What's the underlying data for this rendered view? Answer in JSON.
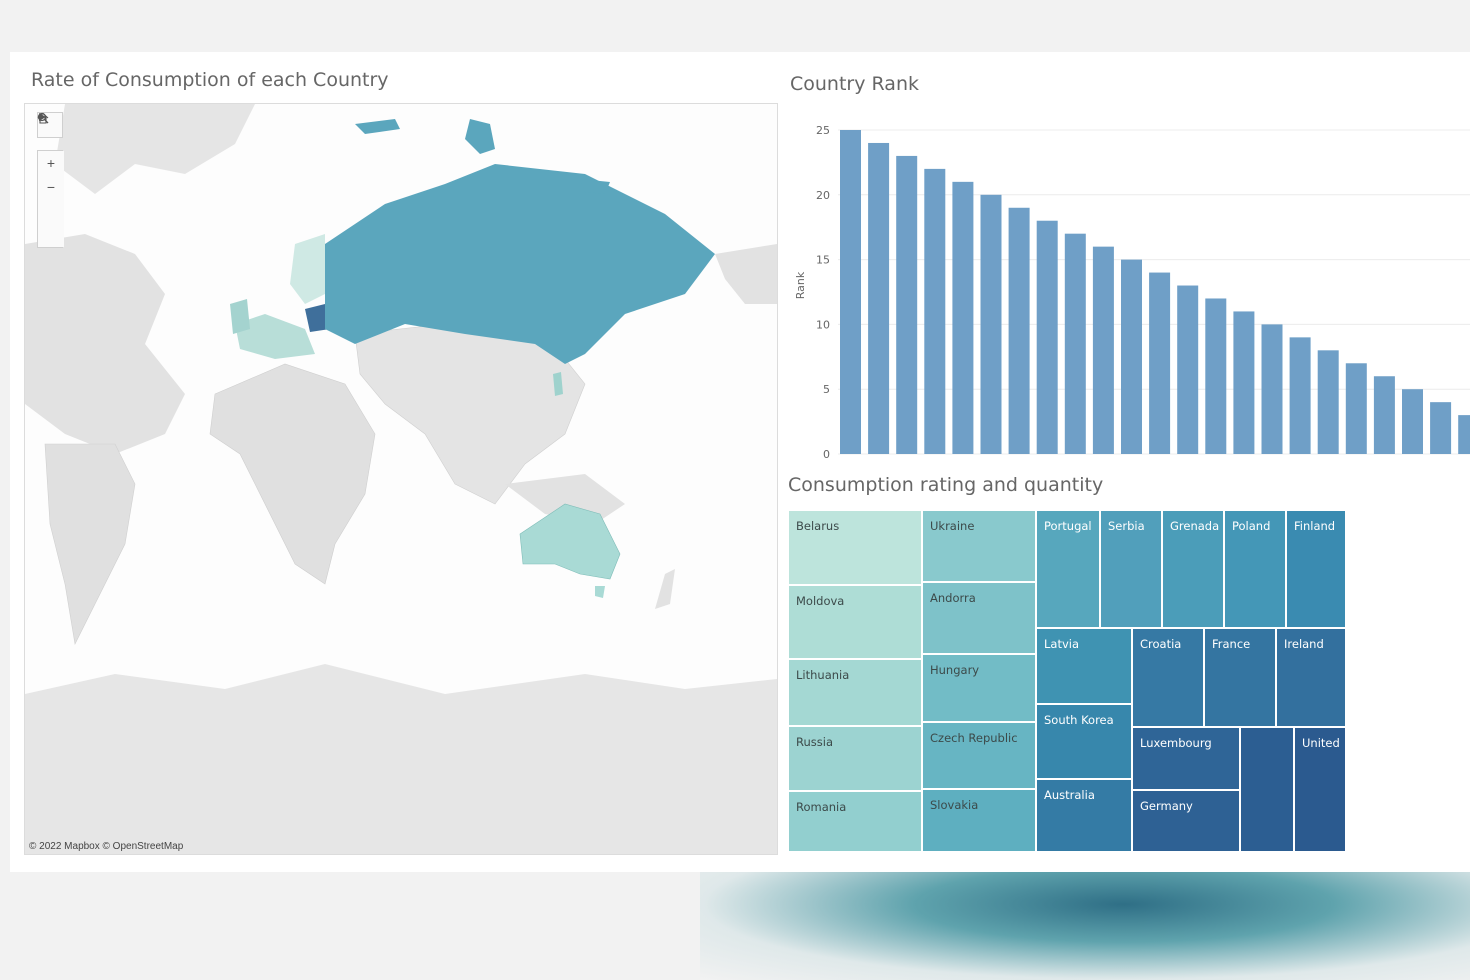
{
  "map_panel": {
    "title": "Rate of Consumption of each Country",
    "credit": "© 2022 Mapbox  © OpenStreetMap",
    "tools": {
      "search_icon": "search-icon",
      "zoom_in": "+",
      "zoom_out": "−",
      "home_icon": "home-icon",
      "expand_icon": "play-icon"
    }
  },
  "rank_panel": {
    "title": "Country Rank"
  },
  "treemap_panel": {
    "title": "Consumption rating and quantity"
  },
  "chart_data": [
    {
      "type": "bar",
      "chart": "Country Rank",
      "ylabel": "Rank",
      "ylim": [
        0,
        25
      ],
      "yticks": [
        0,
        5,
        10,
        15,
        20,
        25
      ],
      "grid": true,
      "values": [
        25,
        24,
        23,
        22,
        21,
        20,
        19,
        18,
        17,
        16,
        15,
        14,
        13,
        12,
        11,
        10,
        9,
        8,
        7,
        6,
        5,
        4,
        3
      ],
      "bar_color": "#6f9fc7"
    },
    {
      "type": "treemap",
      "chart": "Consumption rating and quantity",
      "columns": [
        {
          "color": "#bfe3dc",
          "items": [
            {
              "label": "Belarus",
              "share": 0.22,
              "color": "#bde4dc"
            },
            {
              "label": "Moldova",
              "share": 0.215,
              "color": "#aeddd6"
            },
            {
              "label": "Lithuania",
              "share": 0.195,
              "color": "#a4d8d3"
            },
            {
              "label": "Russia",
              "share": 0.19,
              "color": "#9cd3d1"
            },
            {
              "label": "Romania",
              "share": 0.18,
              "color": "#92cfcf"
            }
          ]
        },
        {
          "items": [
            {
              "label": "Ukraine",
              "share": 0.21,
              "color": "#89c9cd"
            },
            {
              "label": "Andorra",
              "share": 0.21,
              "color": "#7ec2c9"
            },
            {
              "label": "Hungary",
              "share": 0.2,
              "color": "#72bcc6"
            },
            {
              "label": "Czech Republic",
              "share": 0.195,
              "color": "#67b5c3"
            },
            {
              "label": "Slovakia",
              "share": 0.185,
              "color": "#5eafc0"
            }
          ]
        }
      ],
      "top_row": [
        {
          "label": "Portugal",
          "color": "#57a7bd"
        },
        {
          "label": "Serbia",
          "color": "#519fbb"
        },
        {
          "label": "Grenada",
          "color": "#4b9db9"
        },
        {
          "label": "Poland",
          "color": "#4497b7"
        },
        {
          "label": "Finland",
          "color": "#3a8bb1"
        }
      ],
      "lower_left": [
        {
          "label": "Latvia",
          "color": "#3f93b2"
        },
        {
          "label": "South Korea",
          "color": "#3787ac"
        },
        {
          "label": "Australia",
          "color": "#347ba5"
        }
      ],
      "lower_mid_top": [
        {
          "label": "Croatia",
          "color": "#3679a4"
        },
        {
          "label": "France",
          "color": "#3475a1"
        },
        {
          "label": "Ireland",
          "color": "#33709e"
        }
      ],
      "lower_bottom": [
        {
          "label": "Luxembourg",
          "color": "#2f6597"
        },
        {
          "label": "Germany",
          "color": "#2e6194"
        },
        {
          "label": "",
          "color": "#2c5e92"
        },
        {
          "label": "United",
          "color": "#2b5a8f"
        }
      ]
    }
  ]
}
